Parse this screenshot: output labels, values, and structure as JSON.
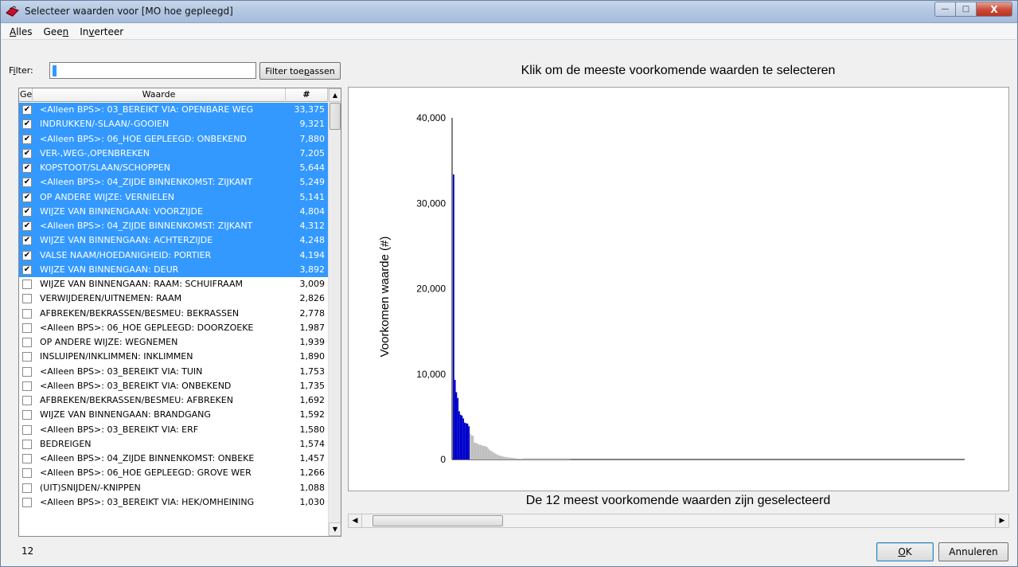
{
  "window": {
    "title": "Selecteer waarden voor [MO hoe gepleegd]",
    "minimize_label": "—",
    "maximize_label": "□",
    "close_label": "X"
  },
  "menu": {
    "alles": "Alles",
    "geen": "Geen",
    "inverteer": "Inverteer"
  },
  "filter": {
    "label": "Filter:",
    "value": "",
    "button_label": "Filter toepassen"
  },
  "list": {
    "headers": {
      "ge": "Ge",
      "waarde": "Waarde",
      "count": "#"
    },
    "rows": [
      {
        "label": "<Alleen BPS>: 03_BEREIKT VIA: OPENBARE WEG",
        "count": "33,375",
        "checked": true
      },
      {
        "label": "INDRUKKEN/-SLAAN/-GOOIEN",
        "count": "9,321",
        "checked": true
      },
      {
        "label": "<Alleen BPS>: 06_HOE GEPLEEGD: ONBEKEND",
        "count": "7,880",
        "checked": true
      },
      {
        "label": "VER-,WEG-,OPENBREKEN",
        "count": "7,205",
        "checked": true
      },
      {
        "label": "KOPSTOOT/SLAAN/SCHOPPEN",
        "count": "5,644",
        "checked": true
      },
      {
        "label": "<Alleen BPS>: 04_ZIJDE BINNENKOMST: ZIJKANT",
        "count": "5,249",
        "checked": true
      },
      {
        "label": "OP ANDERE WIJZE: VERNIELEN",
        "count": "5,141",
        "checked": true
      },
      {
        "label": "WIJZE VAN BINNENGAAN: VOORZIJDE",
        "count": "4,804",
        "checked": true
      },
      {
        "label": "<Alleen BPS>: 04_ZIJDE BINNENKOMST: ZIJKANT",
        "count": "4,312",
        "checked": true
      },
      {
        "label": "WIJZE VAN BINNENGAAN: ACHTERZIJDE",
        "count": "4,248",
        "checked": true
      },
      {
        "label": "VALSE NAAM/HOEDANIGHEID: PORTIER",
        "count": "4,194",
        "checked": true
      },
      {
        "label": "WIJZE VAN BINNENGAAN: DEUR",
        "count": "3,892",
        "checked": true
      },
      {
        "label": "WIJZE VAN BINNENGAAN: RAAM: SCHUIFRAAM",
        "count": "3,009",
        "checked": false
      },
      {
        "label": "VERWIJDEREN/UITNEMEN: RAAM",
        "count": "2,826",
        "checked": false
      },
      {
        "label": "AFBREKEN/BEKRASSEN/BESMEU: BEKRASSEN",
        "count": "2,778",
        "checked": false
      },
      {
        "label": "<Alleen BPS>: 06_HOE GEPLEEGD: DOORZOEKE",
        "count": "1,987",
        "checked": false
      },
      {
        "label": "OP ANDERE WIJZE: WEGNEMEN",
        "count": "1,939",
        "checked": false
      },
      {
        "label": "INSLUIPEN/INKLIMMEN: INKLIMMEN",
        "count": "1,890",
        "checked": false
      },
      {
        "label": "<Alleen BPS>: 03_BEREIKT VIA: TUIN",
        "count": "1,753",
        "checked": false
      },
      {
        "label": "<Alleen BPS>: 03_BEREIKT VIA: ONBEKEND",
        "count": "1,735",
        "checked": false
      },
      {
        "label": "AFBREKEN/BEKRASSEN/BESMEU: AFBREKEN",
        "count": "1,692",
        "checked": false
      },
      {
        "label": "WIJZE VAN BINNENGAAN: BRANDGANG",
        "count": "1,592",
        "checked": false
      },
      {
        "label": "<Alleen BPS>: 03_BEREIKT VIA: ERF",
        "count": "1,580",
        "checked": false
      },
      {
        "label": "BEDREIGEN",
        "count": "1,574",
        "checked": false
      },
      {
        "label": "<Alleen BPS>: 04_ZIJDE BINNENKOMST: ONBEKE",
        "count": "1,457",
        "checked": false
      },
      {
        "label": "<Alleen BPS>: 06_HOE GEPLEEGD: GROVE WER",
        "count": "1,266",
        "checked": false
      },
      {
        "label": "(UIT)SNIJDEN/-KNIPPEN",
        "count": "1,088",
        "checked": false
      },
      {
        "label": "<Alleen BPS>: 03_BEREIKT VIA: HEK/OMHEINING",
        "count": "1,030",
        "checked": false
      }
    ]
  },
  "chart_title": "Klik om de meeste voorkomende waarden te selecteren",
  "chart_status": "De 12 meest voorkomende waarden zijn geselecteerd",
  "chart_data": {
    "type": "bar",
    "ylabel": "Voorkomen waarde (#)",
    "xlabel": "",
    "ylim": [
      0,
      40000
    ],
    "yticks": [
      "0",
      "10,000",
      "20,000",
      "30,000",
      "40,000"
    ],
    "grid": false,
    "selected_count": 12,
    "values": [
      33375,
      9321,
      7880,
      7205,
      5644,
      5249,
      5141,
      4804,
      4312,
      4248,
      4194,
      3892,
      3009,
      2826,
      2778,
      1987,
      1939,
      1890,
      1753,
      1735,
      1692,
      1592,
      1580,
      1574,
      1457,
      1266,
      1088,
      1030,
      900,
      800,
      700,
      600,
      520,
      460,
      410,
      370,
      330,
      300,
      270,
      250,
      230,
      210,
      190,
      170,
      150,
      130,
      110,
      100,
      90,
      80
    ],
    "colors": {
      "selected": "#0000cc",
      "unselected": "#c0c0c0"
    }
  },
  "footer": {
    "selected_count": "12",
    "ok_label": "OK",
    "cancel_label": "Annuleren"
  }
}
